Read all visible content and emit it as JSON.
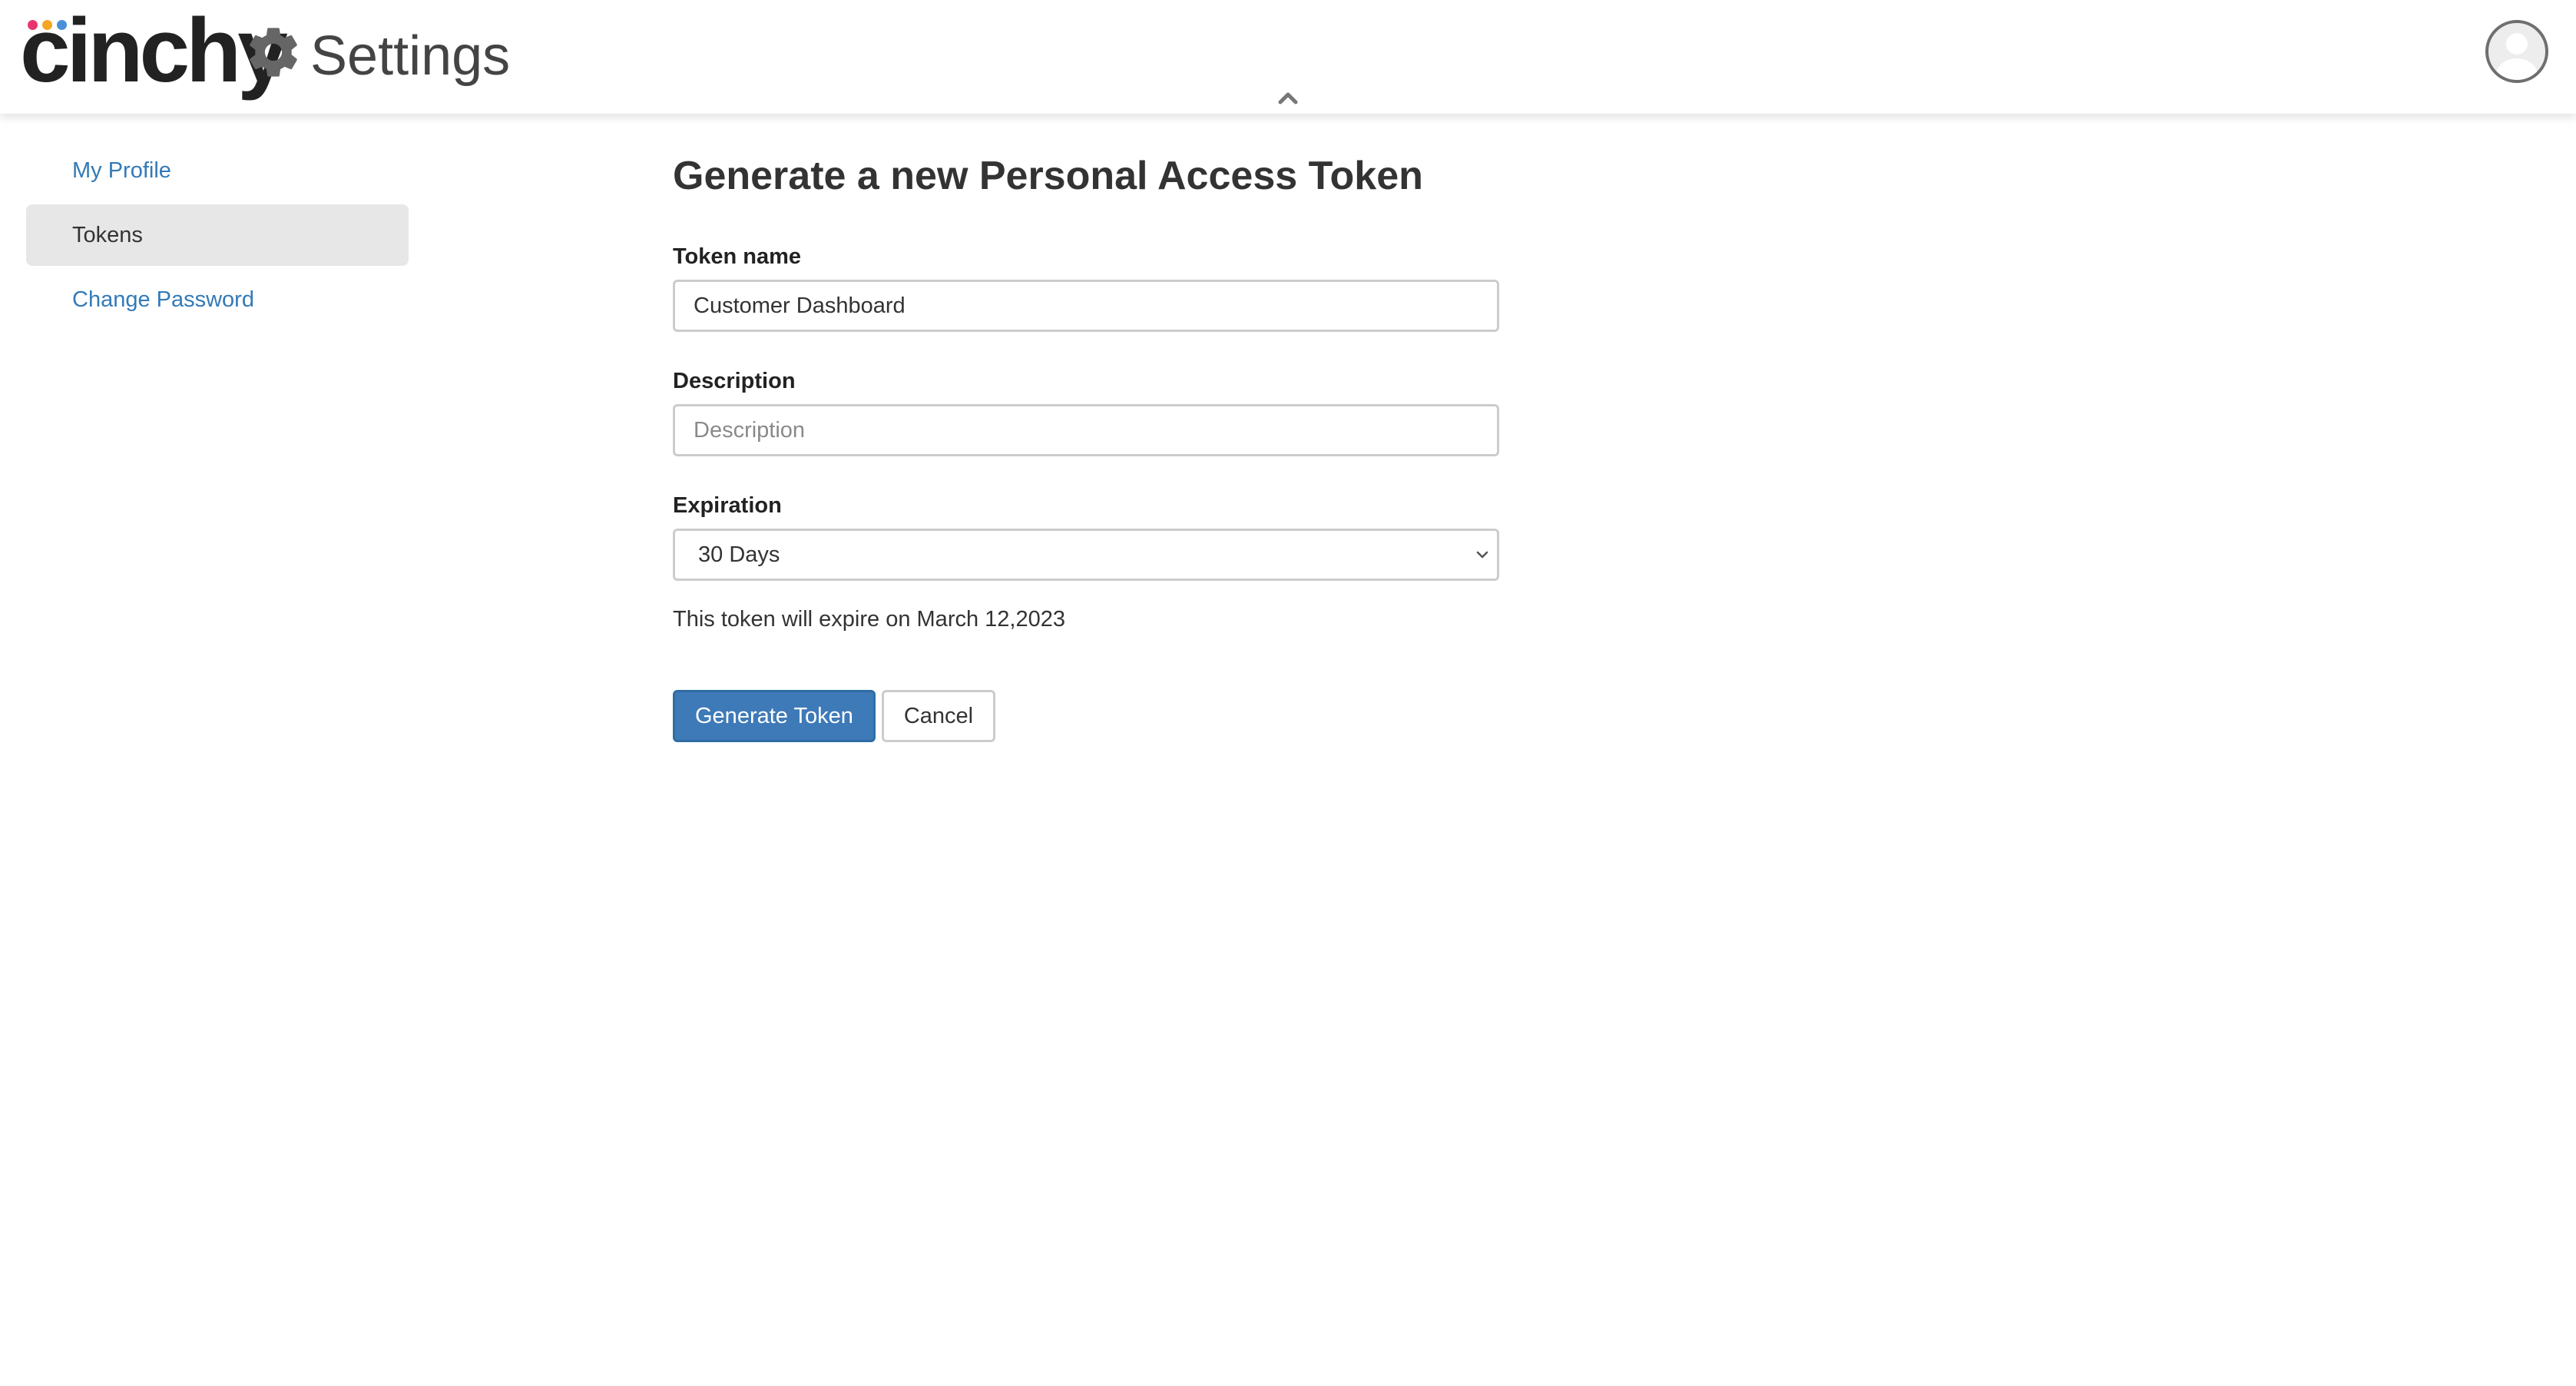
{
  "header": {
    "logo_text": "cinchy",
    "logo_dot_colors": [
      "#e8356d",
      "#f5a623",
      "#4a90d9"
    ],
    "title": "Settings",
    "gear_icon": "gear-icon",
    "collapse_icon": "chevron-up-icon",
    "avatar_icon": "user-avatar-icon"
  },
  "sidebar": {
    "items": [
      {
        "label": "My Profile",
        "active": false
      },
      {
        "label": "Tokens",
        "active": true
      },
      {
        "label": "Change Password",
        "active": false
      }
    ]
  },
  "form": {
    "title": "Generate a new Personal Access Token",
    "token_name": {
      "label": "Token name",
      "value": "Customer Dashboard"
    },
    "description": {
      "label": "Description",
      "value": "",
      "placeholder": "Description"
    },
    "expiration": {
      "label": "Expiration",
      "selected": "30 Days"
    },
    "expire_note": "This token will expire on March 12,2023",
    "generate_label": "Generate Token",
    "cancel_label": "Cancel"
  },
  "colors": {
    "accent": "#337ab7",
    "primary_button": "#3f7ab8",
    "active_sidebar_bg": "#e7e7e7"
  }
}
